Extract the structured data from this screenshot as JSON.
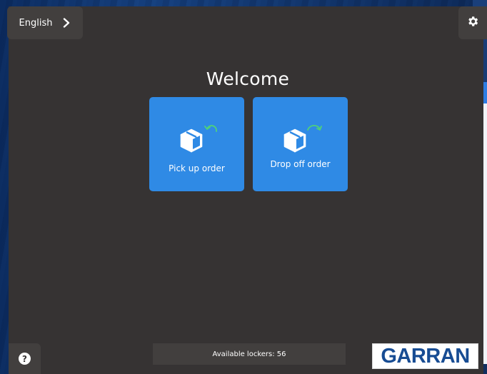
{
  "header": {
    "language_label": "English",
    "chevron_icon": "chevron-right-icon",
    "settings_icon": "gear-icon"
  },
  "main": {
    "title": "Welcome",
    "tiles": [
      {
        "label": "Pick up order",
        "icon": "package-return-icon"
      },
      {
        "label": "Drop off order",
        "icon": "package-send-icon"
      }
    ]
  },
  "footer": {
    "help_icon": "question-icon",
    "help_glyph": "?",
    "status_text": "Available lockers: 56",
    "logo_text": "GARRAN"
  },
  "colors": {
    "screen_bg": "#363333",
    "panel_bg": "#423f3e",
    "tile_blue": "#2f8ae5",
    "arrow_green": "#4fd17a",
    "logo_blue": "#174c93"
  }
}
